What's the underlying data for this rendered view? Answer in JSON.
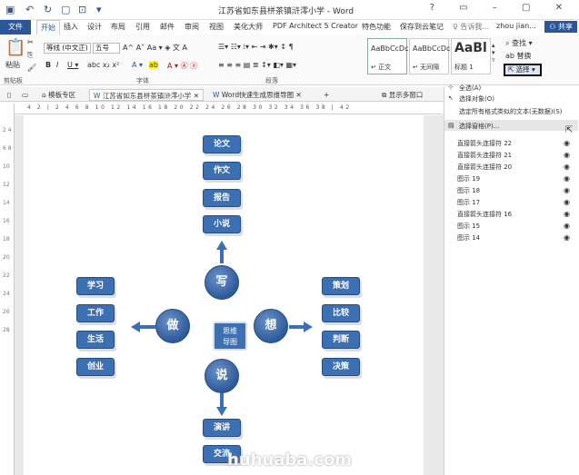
{
  "titlebar": {
    "title": "江苏省如东县栟茶镇浒澪小学 - Word",
    "win_controls": "? ▭ – ▢ ✕"
  },
  "tabs": {
    "file": "文件",
    "home": "开始",
    "items": [
      "插入",
      "设计",
      "布局",
      "引用",
      "邮件",
      "审阅",
      "视图",
      "美化大师",
      "PDF Architect 5 Creator",
      "特色功能",
      "保存到云笔记"
    ],
    "tell": "♀ 告诉我...",
    "user": "zhou jian...",
    "share": "共享"
  },
  "ribbon": {
    "paste": "粘贴",
    "clipboard": "剪贴板",
    "font_name": "等线 (中文正)",
    "font_size": "五号",
    "font_group": "字体",
    "para_group": "段落",
    "styles": [
      {
        "sample": "AaBbCcDc",
        "name": "↵ 正文"
      },
      {
        "sample": "AaBbCcDc",
        "name": "↵ 无间隔"
      },
      {
        "sample": "AaBl",
        "name": "标题 1"
      }
    ],
    "find": "查找",
    "replace": "替换",
    "select": "选择"
  },
  "doctabs": {
    "t1": "模板专区",
    "t2": "江苏省如东县栟茶镇浒澪小学",
    "t3": "Word快速生成思维导图",
    "show": "显示多窗口"
  },
  "ruler": {
    "nums": "4 2 | 2 4 6 8 10 12 14 16 18 20 22 24 26 28 30 32 34 36 38 | 42",
    "vnums": "2 4 6 8 10 12 14 16 18 20 22 24 26 28"
  },
  "mindmap": {
    "center": {
      "l1": "思维",
      "l2": "导图"
    },
    "circles": {
      "top": "写",
      "left": "做",
      "right": "想",
      "bottom": "说"
    },
    "top_items": [
      "论文",
      "作文",
      "报告",
      "小说"
    ],
    "left_items": [
      "学习",
      "工作",
      "生活",
      "创业"
    ],
    "right_items": [
      "策划",
      "比较",
      "判断",
      "决策"
    ],
    "bottom_items": [
      "演讲",
      "交流"
    ]
  },
  "pane": {
    "select_all": "全选(A)",
    "select_objects": "选择对象(O)",
    "select_similar": "选定所有格式类似的文本(无数据)(S)",
    "selection_pane": "选择窗格(P)...",
    "objects": [
      "直接箭头连接符 22",
      "直接箭头连接符 21",
      "直接箭头连接符 20",
      "图示 19",
      "图示 18",
      "图示 17",
      "直接箭头连接符 16",
      "图示 15",
      "图示 14"
    ]
  },
  "watermark": "huhuaba.com"
}
